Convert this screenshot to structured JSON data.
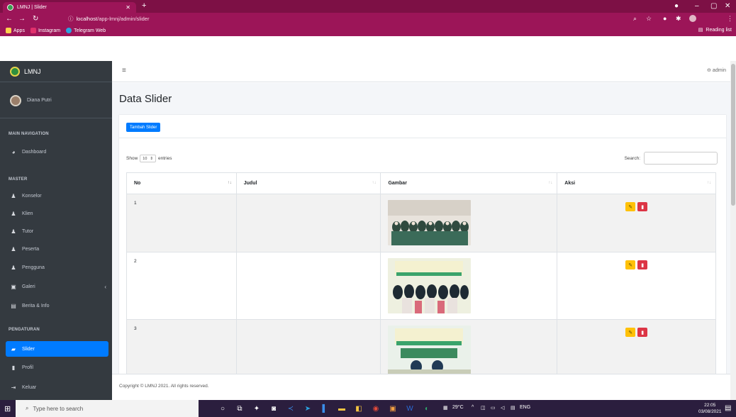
{
  "browser": {
    "tab_title": "LMNJ | Slider",
    "url_host": "localhost",
    "url_path": "/app-lmnj/admin/slider",
    "bookmarks": [
      {
        "label": "Apps",
        "color": "#ffd04d"
      },
      {
        "label": "Instagram",
        "color": "#e1306c"
      },
      {
        "label": "Telegram Web",
        "color": "#2aa3e0"
      }
    ],
    "reading_list": "Reading list"
  },
  "app": {
    "brand": "LMNJ",
    "user_name": "Diana Putri",
    "admin_label": "admin",
    "page_title": "Data Slider",
    "add_button": "Tambah Slider",
    "sections": {
      "main_nav": "MAIN NAVIGATION",
      "master": "MASTER",
      "settings": "PENGATURAN"
    },
    "nav_items": [
      {
        "label": "Dashboard",
        "icon": "dashboard-icon"
      },
      {
        "label": "Konselor",
        "icon": "user-icon"
      },
      {
        "label": "Klien",
        "icon": "user-icon"
      },
      {
        "label": "Tutor",
        "icon": "user-icon"
      },
      {
        "label": "Peserta",
        "icon": "user-icon"
      },
      {
        "label": "Pengguna",
        "icon": "user-icon"
      },
      {
        "label": "Galeri",
        "icon": "gallery-icon"
      },
      {
        "label": "Berita & Info",
        "icon": "news-icon"
      },
      {
        "label": "Slider",
        "icon": "slider-icon"
      },
      {
        "label": "Profil",
        "icon": "profile-icon"
      },
      {
        "label": "Keluar",
        "icon": "logout-icon"
      }
    ],
    "active_item": "Slider"
  },
  "table": {
    "show_label": "Show",
    "entries_value": "10",
    "entries_label": "entries",
    "search_label": "Search:",
    "search_value": "",
    "columns": [
      "No",
      "Judul",
      "Gambar",
      "Aksi"
    ],
    "rows": [
      {
        "no": "1",
        "judul": "",
        "image": "group-photo"
      },
      {
        "no": "2",
        "judul": "",
        "image": "talk-show-photo"
      },
      {
        "no": "3",
        "judul": "",
        "image": "talk-show-photo"
      }
    ]
  },
  "footer": {
    "copyright": "Copyright © LMNJ 2021. All rights reserved."
  },
  "taskbar": {
    "search_placeholder": "Type here to search",
    "weather": "29°C",
    "lang": "ENG",
    "time": "22:05",
    "date": "03/08/2021"
  },
  "colors": {
    "browser_theme": "#9c1558",
    "sidebar": "#343a40",
    "active": "#007bff",
    "edit": "#ffc107",
    "delete": "#dc3545"
  }
}
